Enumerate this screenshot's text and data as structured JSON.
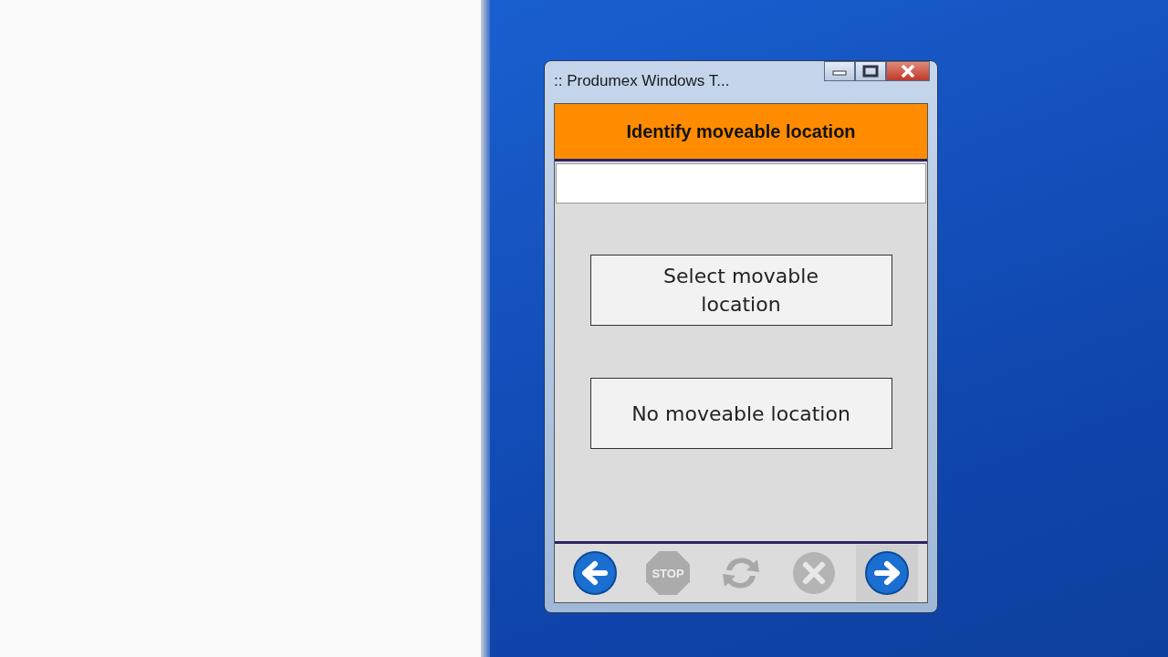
{
  "window": {
    "title": ":: Produmex Windows T..."
  },
  "header": {
    "title": "Identify moveable location"
  },
  "options": [
    {
      "label": "Select movable location"
    },
    {
      "label": "No moveable location"
    }
  ],
  "toolbar": [
    {
      "kind": "back",
      "disabled": false,
      "hovered": false
    },
    {
      "kind": "stop",
      "label": "STOP",
      "disabled": true,
      "hovered": false
    },
    {
      "kind": "refresh",
      "disabled": true,
      "hovered": false
    },
    {
      "kind": "cancel",
      "disabled": true,
      "hovered": false
    },
    {
      "kind": "next",
      "disabled": false,
      "hovered": true
    }
  ]
}
